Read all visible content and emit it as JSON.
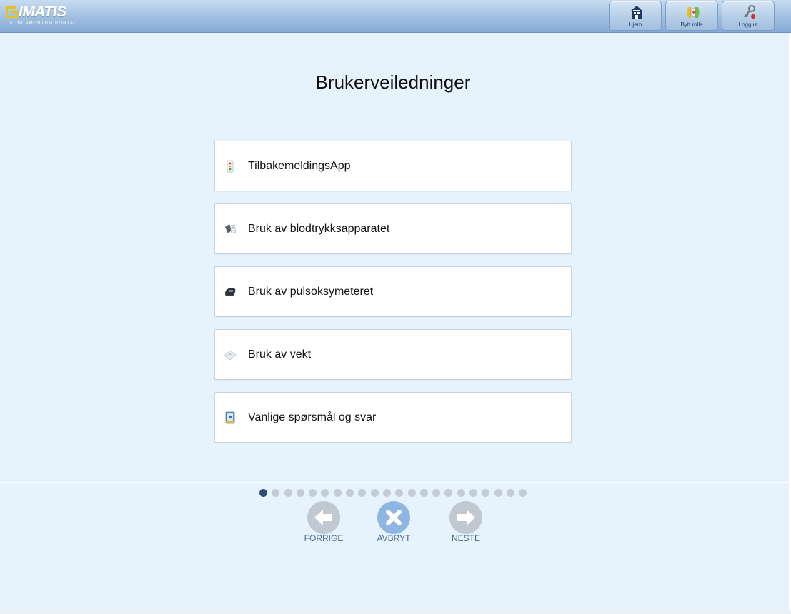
{
  "app": {
    "logo_text": "IMATIS",
    "logo_subtitle": "FUNDAMENTUM PORTAL"
  },
  "header": {
    "buttons": [
      {
        "label": "Hjem",
        "icon": "house-icon"
      },
      {
        "label": "Bytt rolle",
        "icon": "switch-role-icon"
      },
      {
        "label": "Logg ut",
        "icon": "key-icon"
      }
    ]
  },
  "page": {
    "title": "Brukerveiledninger"
  },
  "guides": [
    {
      "label": "TilbakemeldingsApp",
      "icon": "feedback-app-icon"
    },
    {
      "label": "Bruk av blodtrykksapparatet",
      "icon": "blood-pressure-icon"
    },
    {
      "label": "Bruk av pulsoksymeteret",
      "icon": "pulse-oximeter-icon"
    },
    {
      "label": "Bruk av vekt",
      "icon": "scale-icon"
    },
    {
      "label": "Vanlige spørsmål og svar",
      "icon": "faq-book-icon"
    }
  ],
  "pagination": {
    "total_pages": 22,
    "current_page": 1
  },
  "navigation": {
    "previous_label": "FORRIGE",
    "cancel_label": "AVBRYT",
    "next_label": "NESTE"
  },
  "colors": {
    "background": "#e6f2fc",
    "header": "#9fbfe0",
    "logo_accent": "#e6c21a",
    "active_dot": "#2e4d6e",
    "inactive_dot": "#c3ccd7",
    "nav_disabled": "#c0c8d2",
    "nav_cancel": "#8fb6e3"
  }
}
